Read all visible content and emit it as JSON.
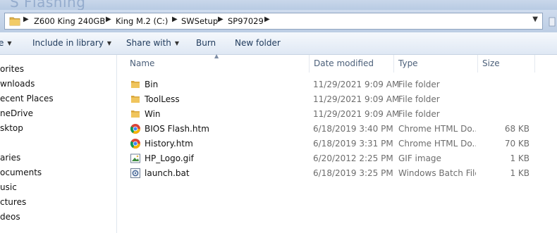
{
  "window": {
    "title": "S Flashing"
  },
  "address_bar": {
    "crumbs": [
      "Z600 King 240GB",
      "King M.2 (C:)",
      "SWSetup",
      "SP97029"
    ]
  },
  "toolbar": {
    "organize_label": "e",
    "include_label": "Include in library",
    "share_label": "Share with",
    "burn_label": "Burn",
    "new_folder_label": "New folder"
  },
  "nav": {
    "favorites": "orites",
    "downloads": "wnloads",
    "recent": "ecent Places",
    "onedrive": "neDrive",
    "desktop": "sktop",
    "libraries": "aries",
    "documents": "ocuments",
    "music": "usic",
    "pictures": "ctures",
    "videos": "deos"
  },
  "columns": {
    "name": "Name",
    "date": "Date modified",
    "type": "Type",
    "size": "Size"
  },
  "files": [
    {
      "name": "Bin",
      "date": "11/29/2021 9:09 AM",
      "type": "File folder",
      "size": "",
      "icon": "folder-icon"
    },
    {
      "name": "ToolLess",
      "date": "11/29/2021 9:09 AM",
      "type": "File folder",
      "size": "",
      "icon": "folder-icon"
    },
    {
      "name": "Win",
      "date": "11/29/2021 9:09 AM",
      "type": "File folder",
      "size": "",
      "icon": "folder-icon"
    },
    {
      "name": "BIOS Flash.htm",
      "date": "6/18/2019 3:40 PM",
      "type": "Chrome HTML Do...",
      "size": "68 KB",
      "icon": "chrome-icon"
    },
    {
      "name": "History.htm",
      "date": "6/18/2019 3:31 PM",
      "type": "Chrome HTML Do...",
      "size": "70 KB",
      "icon": "chrome-icon"
    },
    {
      "name": "HP_Logo.gif",
      "date": "6/20/2012 2:25 PM",
      "type": "GIF image",
      "size": "1 KB",
      "icon": "image-icon"
    },
    {
      "name": "launch.bat",
      "date": "6/18/2019 3:25 PM",
      "type": "Windows Batch File",
      "size": "1 KB",
      "icon": "batch-file-icon"
    }
  ],
  "colors": {
    "folder": "#e8b84a",
    "chrome_red": "#db4437",
    "chrome_green": "#0f9d58",
    "chrome_yellow": "#f4b400",
    "chrome_blue": "#4285f4"
  }
}
